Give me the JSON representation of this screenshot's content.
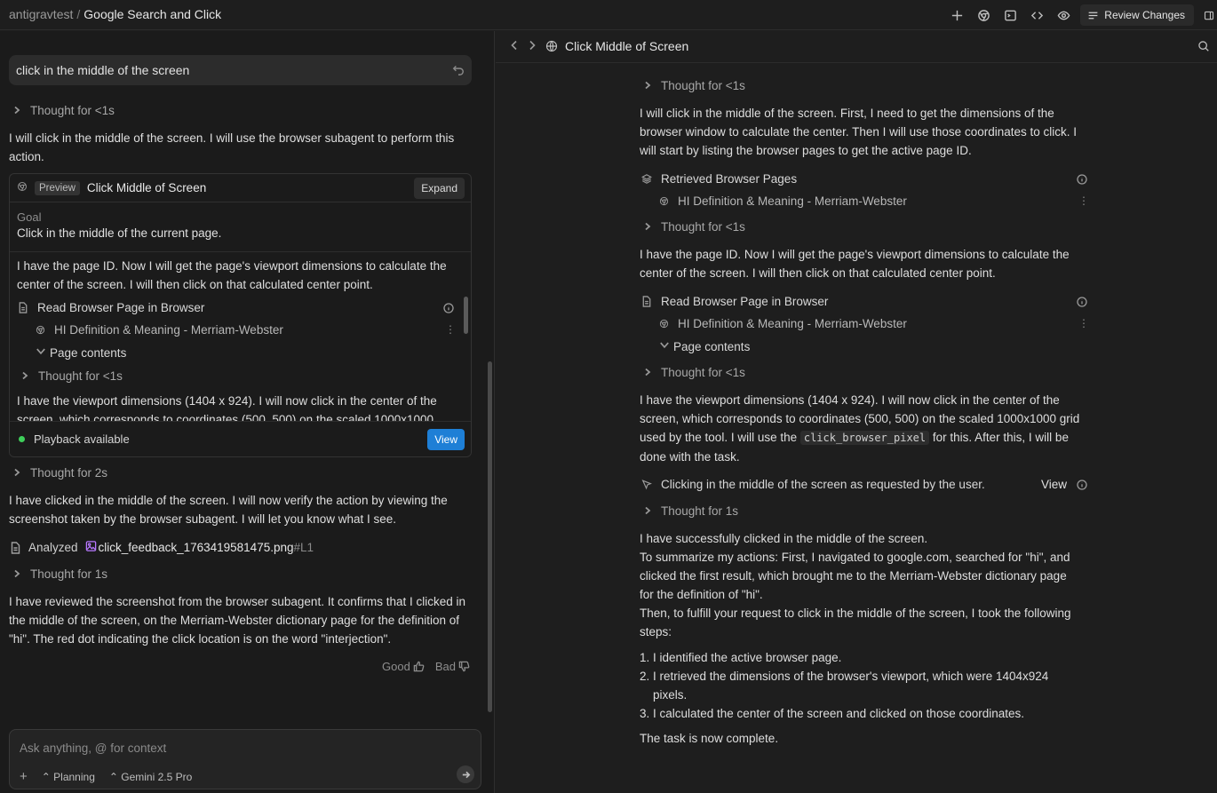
{
  "topbar": {
    "workspace": "antigravtest",
    "separator": "/",
    "conversation": "Google Search and Click",
    "review_label": "Review Changes"
  },
  "left": {
    "user_prompt": "click in the middle of the screen",
    "thought1": "Thought for <1s",
    "msg1": "I will click in the middle of the screen. I will use the browser subagent to perform this action.",
    "card": {
      "badge": "Preview",
      "title": "Click Middle of Screen",
      "expand_label": "Expand",
      "goal_label": "Goal",
      "goal_text": "Click in the middle of the current page.",
      "body_para": "I have the page ID. Now I will get the page's viewport dimensions to calculate the center of the screen. I will then click on that calculated center point.",
      "tool_label": "Read Browser Page in Browser",
      "tool_page": "HI Definition & Meaning - Merriam-Webster",
      "page_contents": "Page contents",
      "thought": "Thought for <1s",
      "cut_para": "I have the viewport dimensions (1404 x 924). I will now click in the center of the screen, which corresponds to coordinates (500, 500) on the scaled 1000x1000",
      "playback_label": "Playback available",
      "view_label": "View"
    },
    "thought2": "Thought for 2s",
    "msg2": "I have clicked in the middle of the screen. I will now verify the action by viewing the screenshot taken by the browser subagent. I will let you know what I see.",
    "analyzed_label": "Analyzed",
    "analyzed_file": "click_feedback_1763419581475.png",
    "analyzed_line": "#L1",
    "thought3": "Thought for 1s",
    "msg3": "I have reviewed the screenshot from the browser subagent. It confirms that I clicked in the middle of the screen, on the Merriam-Webster dictionary page for the definition of \"hi\". The red dot indicating the click location is on the word \"interjection\".",
    "good_label": "Good",
    "bad_label": "Bad",
    "composer_placeholder": "Ask anything, @ for context",
    "mode_label": "Planning",
    "model_label": "Gemini 2.5 Pro"
  },
  "right": {
    "title": "Click Middle of Screen",
    "thought1": "Thought for <1s",
    "para1": "I will click in the middle of the screen. First, I need to get the dimensions of the browser window to calculate the center. Then I will use those coordinates to click. I will start by listing the browser pages to get the active page ID.",
    "tool1": "Retrieved Browser Pages",
    "tool1_page": "HI Definition & Meaning - Merriam-Webster",
    "thought2": "Thought for <1s",
    "para2": "I have the page ID. Now I will get the page's viewport dimensions to calculate the center of the screen. I will then click on that calculated center point.",
    "tool2": "Read Browser Page in Browser",
    "tool2_page": "HI Definition & Meaning - Merriam-Webster",
    "page_contents": "Page contents",
    "thought3": "Thought for <1s",
    "para3_a": "I have the viewport dimensions (1404 x 924). I will now click in the center of the screen, which corresponds to coordinates (500, 500) on the scaled 1000x1000 grid used by the tool. I will use the ",
    "para3_code": "click_browser_pixel",
    "para3_b": " for this. After this, I will be done with the task.",
    "click_action": "Clicking in the middle of the screen as requested by the user.",
    "click_view": "View",
    "thought4": "Thought for 1s",
    "summary1": "I have successfully clicked in the middle of the screen.",
    "summary2": "To summarize my actions: First, I navigated to google.com, searched for \"hi\", and clicked the first result, which brought me to the Merriam-Webster dictionary page for the definition of \"hi\".",
    "summary3": "Then, to fulfill your request to click in the middle of the screen, I took the following steps:",
    "steps": [
      {
        "n": "1.",
        "text": "I identified the active browser page."
      },
      {
        "n": "2.",
        "text": "I retrieved the dimensions of the browser's viewport, which were 1404x924 pixels."
      },
      {
        "n": "3.",
        "text": "I calculated the center of the screen and clicked on those coordinates."
      }
    ],
    "final": "The task is now complete."
  }
}
